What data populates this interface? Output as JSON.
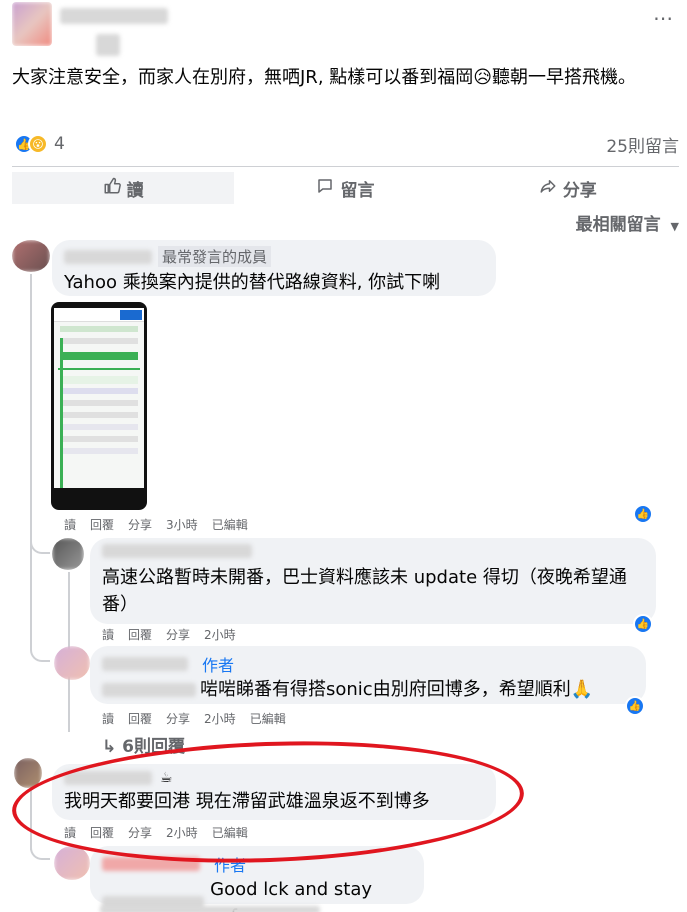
{
  "post": {
    "text": "大家注意安全，而家人在別府，無哂JR, 點樣可以番到福岡😥聽朝一早搭飛機。",
    "reaction_count": "4",
    "comment_count": "25則留言",
    "more_icon": "⋯"
  },
  "actions": {
    "like": "讀",
    "comment": "留言",
    "share": "分享"
  },
  "sort_label": "最相關留言",
  "comments": [
    {
      "badge": "最常發言的成員",
      "text": "Yahoo 乘換案內提供的替代路線資料, 你試下喇",
      "meta": [
        "讀",
        "回覆",
        "分享",
        "3小時",
        "已編輯"
      ]
    },
    {
      "text": "高速公路暫時未開番，巴士資料應該未 update 得切（夜晚希望通番）",
      "meta": [
        "讀",
        "回覆",
        "分享",
        "2小時"
      ]
    },
    {
      "author_tag": "作者",
      "text": "啱啱睇番有得搭sonic由別府回博多，希望順利🙏",
      "meta": [
        "讀",
        "回覆",
        "分享",
        "2小時",
        "已編輯"
      ]
    },
    {
      "text": "我明天都要回港 現在滯留武雄溫泉返不到博多",
      "meta": [
        "讀",
        "回覆",
        "分享",
        "2小時",
        "已編輯"
      ]
    },
    {
      "author_tag": "作者",
      "text": "Good lck and stay safe"
    }
  ],
  "more_replies": "↳ 6則回覆"
}
